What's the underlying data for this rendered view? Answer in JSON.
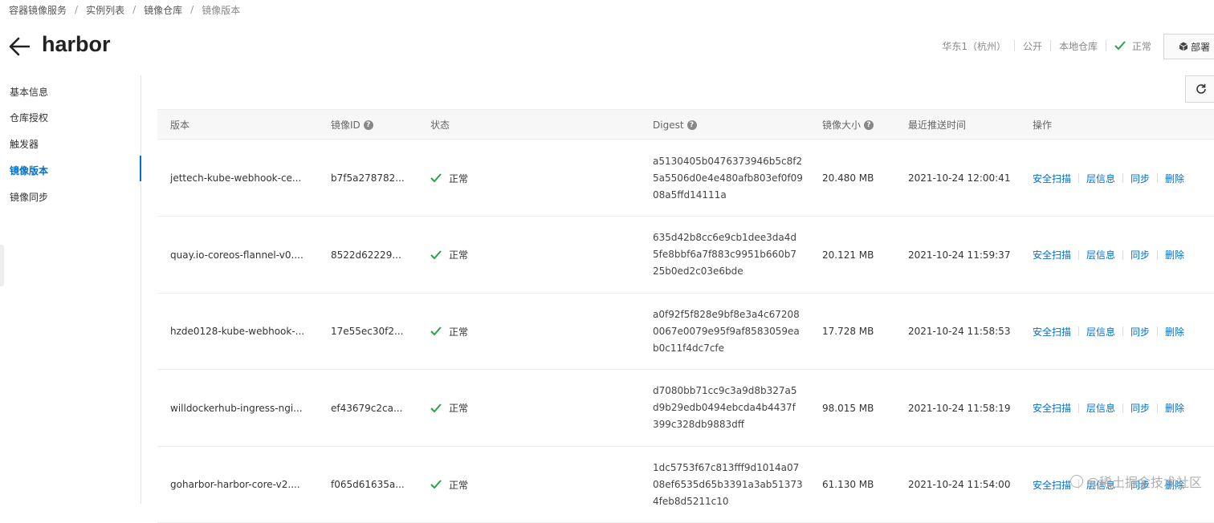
{
  "breadcrumb": [
    "容器镜像服务",
    "实例列表",
    "镜像仓库",
    "镜像版本"
  ],
  "title": "harbor",
  "header_meta": {
    "region": "华东1（杭州）",
    "visibility": "公开",
    "repo_type": "本地仓库",
    "status": "正常",
    "status_color": "#2ba245"
  },
  "deploy_label": "部署",
  "sidebar": {
    "items": [
      {
        "label": "基本信息",
        "active": false
      },
      {
        "label": "仓库授权",
        "active": false
      },
      {
        "label": "触发器",
        "active": false
      },
      {
        "label": "镜像版本",
        "active": true
      },
      {
        "label": "镜像同步",
        "active": false
      }
    ]
  },
  "table": {
    "headers": {
      "version": "版本",
      "image_id": "镜像ID",
      "status": "状态",
      "digest": "Digest",
      "size": "镜像大小",
      "push_time": "最近推送时间",
      "actions": "操作"
    },
    "rows": [
      {
        "version": "jettech-kube-webhook-ce...",
        "image_id": "b7f5a278782...",
        "status": "正常",
        "digest": [
          "a5130405b0476373946b5c8f2",
          "5a5506d0e4e480afb803ef0f09",
          "08a5ffd14111a"
        ],
        "size": "20.480 MB",
        "push_time": "2021-10-24 12:00:41"
      },
      {
        "version": "quay.io-coreos-flannel-v0....",
        "image_id": "8522d62229...",
        "status": "正常",
        "digest": [
          "635d42b8cc6e9cb1dee3da4d",
          "5fe8bbf6a7f883c9951b660b7",
          "25b0ed2c03e6bde"
        ],
        "size": "20.121 MB",
        "push_time": "2021-10-24 11:59:37"
      },
      {
        "version": "hzde0128-kube-webhook-...",
        "image_id": "17e55ec30f2...",
        "status": "正常",
        "digest": [
          "a0f92f5f828e9bf8e3a4c67208",
          "0067e0079e95f9af8583059ea",
          "b0c11f4dc7cfe"
        ],
        "size": "17.728 MB",
        "push_time": "2021-10-24 11:58:53"
      },
      {
        "version": "willdockerhub-ingress-ngi...",
        "image_id": "ef43679c2ca...",
        "status": "正常",
        "digest": [
          "d7080bb71cc9c3a9d8b327a5",
          "d9b29edb0494ebcda4b4437f",
          "399c328db9883dff"
        ],
        "size": "98.015 MB",
        "push_time": "2021-10-24 11:58:19"
      },
      {
        "version": "goharbor-harbor-core-v2....",
        "image_id": "f065d61635a...",
        "status": "正常",
        "digest": [
          "1dc5753f67c813fff9d1014a07",
          "08ef6535d65b3391a3ab51373",
          "4feb8d5211c10"
        ],
        "size": "61.130 MB",
        "push_time": "2021-10-24 11:54:00"
      }
    ],
    "actions": [
      "安全扫描",
      "层信息",
      "同步",
      "删除"
    ]
  },
  "watermark": "@稀土掘金技术社区"
}
